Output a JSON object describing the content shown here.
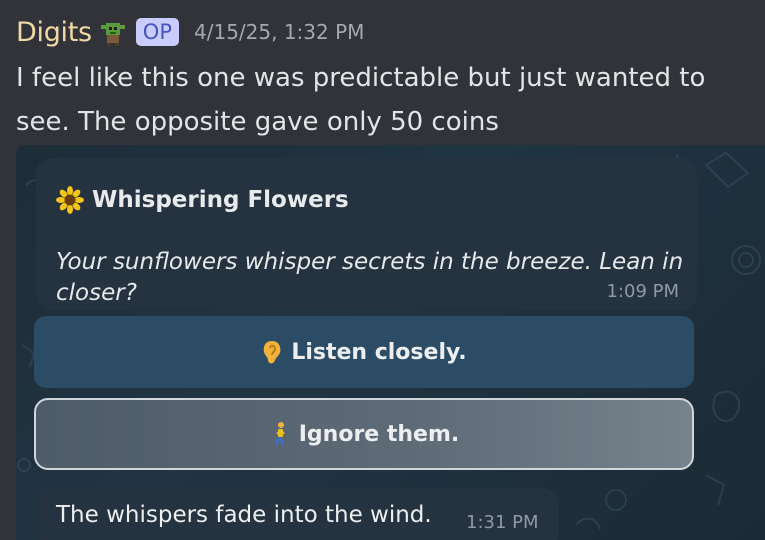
{
  "message": {
    "username": "Digits",
    "badge": "OP",
    "timestamp": "4/15/25, 1:32 PM",
    "text": "I feel like this one was predictable but just wanted to see. The opposite gave only 50 coins",
    "author_icon": "goblin-icon"
  },
  "embed": {
    "card": {
      "icon": "sunflower-icon",
      "title": "Whispering Flowers",
      "body": "Your sunflowers whisper secrets in the breeze. Lean in closer?",
      "time": "1:09 PM"
    },
    "buttons": [
      {
        "icon": "ear-icon",
        "label": "Listen closely."
      },
      {
        "icon": "walking-person-icon",
        "label": "Ignore them."
      }
    ],
    "reply": {
      "text": "The whispers fade into the wind.",
      "time": "1:31 PM"
    }
  },
  "colors": {
    "username": "#f1d9a6",
    "badge_bg": "#c9cdfb",
    "badge_text": "#4654c0",
    "app_bg": "#323339",
    "bubble_bg": "#24333f",
    "button_primary": "#2c4b64"
  }
}
